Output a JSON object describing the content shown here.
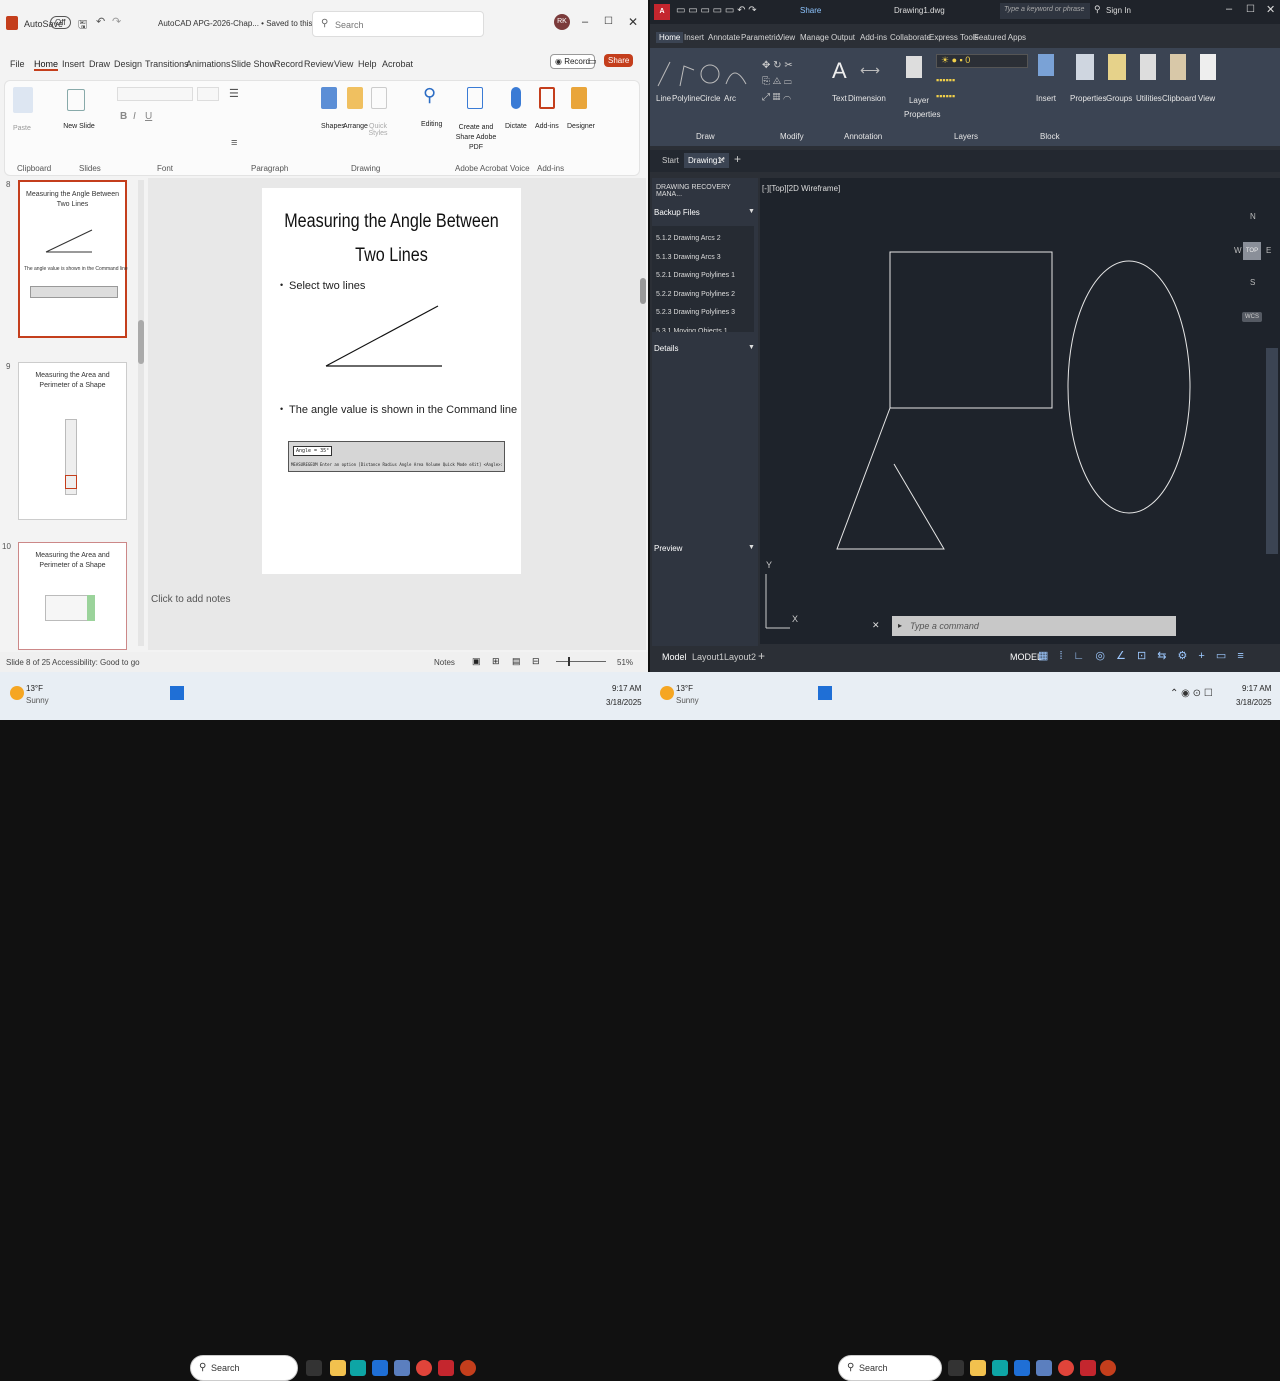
{
  "ppt": {
    "autosave": "AutoSave",
    "autosave_state": "Off",
    "title": "AutoCAD APG-2026-Chap... • Saved to this PC",
    "search_placeholder": "Search",
    "avatar": "RK",
    "record": "Record",
    "share": "Share",
    "tabs": [
      "File",
      "Home",
      "Insert",
      "Draw",
      "Design",
      "Transitions",
      "Animations",
      "Slide Show",
      "Record",
      "Review",
      "View",
      "Help",
      "Acrobat"
    ],
    "ribbon_buttons": {
      "paste": "Paste",
      "new_slide": "New Slide",
      "shapes": "Shapes",
      "arrange": "Arrange",
      "quick_styles": "Quick Styles",
      "editing": "Editing",
      "create_pdf": "Create and Share Adobe PDF",
      "dictate": "Dictate",
      "addins": "Add-ins",
      "designer": "Designer"
    },
    "groups": [
      "Clipboard",
      "Slides",
      "Font",
      "Paragraph",
      "Drawing",
      "Adobe Acrobat",
      "Voice",
      "Add-ins"
    ],
    "thumbnails": [
      {
        "num": "8",
        "title": "Measuring the Angle Between Two Lines",
        "caption": "The angle value is shown in the Command line"
      },
      {
        "num": "9",
        "title": "Measuring the Area and Perimeter of a Shape",
        "caption": ""
      },
      {
        "num": "10",
        "title": "Measuring the Area and Perimeter of a Shape",
        "caption": ""
      }
    ],
    "slide": {
      "title": "Measuring the Angle Between Two Lines",
      "bullet1": "Select two lines",
      "bullet2": "The angle value is shown in the Command line",
      "cmd_line1": "Angle = 35°",
      "cmd_line2": "MEASUREGEOM Enter an option [Distance Radius Angle Area Volume Quick Mode eXit] <Angle>:"
    },
    "notes": "Click to add notes",
    "status": {
      "slide": "Slide 8 of 25",
      "accessibility": "Accessibility: Good to go",
      "notes": "Notes",
      "zoom": "51%"
    }
  },
  "acad": {
    "title": "Drawing1.dwg",
    "share": "Share",
    "search_placeholder": "Type a keyword or phrase",
    "signin": "Sign In",
    "tabs": [
      "Home",
      "Insert",
      "Annotate",
      "Parametric",
      "View",
      "Manage",
      "Output",
      "Add-ins",
      "Collaborate",
      "Express Tools",
      "Featured Apps"
    ],
    "draw_tools": [
      "Line",
      "Polyline",
      "Circle",
      "Arc"
    ],
    "tools2": [
      "Text",
      "Dimension",
      "Layer Properties",
      "Insert",
      "Properties",
      "Groups",
      "Utilities",
      "Clipboard",
      "View"
    ],
    "panels": [
      "Draw",
      "Modify",
      "Annotation",
      "Layers",
      "Block"
    ],
    "file_tabs": [
      "Start",
      "Drawing1*"
    ],
    "recovery": {
      "title": "DRAWING RECOVERY MANA...",
      "backup": "Backup Files",
      "files": [
        "5.1.2 Drawing Arcs 2",
        "5.1.3 Drawing Arcs 3",
        "5.2.1 Drawing Polylines 1",
        "5.2.2 Drawing Polylines 2",
        "5.2.3 Drawing Polylines 3",
        "5.3.1 Moving Objects 1"
      ],
      "details": "Details",
      "preview": "Preview"
    },
    "viewport_label": "[-][Top][2D Wireframe]",
    "compass": {
      "n": "N",
      "s": "S",
      "e": "E",
      "w": "W",
      "top": "TOP",
      "wcs": "WCS"
    },
    "cmd_placeholder": "Type a command",
    "layouts": [
      "Model",
      "Layout1",
      "Layout2"
    ],
    "status_model": "MODEL"
  },
  "taskbar_left": {
    "temp": "13°F",
    "cond": "Sunny",
    "search": "Search",
    "time": "9:17 AM",
    "date": "3/18/2025"
  },
  "taskbar_right": {
    "temp": "13°F",
    "cond": "Sunny",
    "search": "Search",
    "time": "9:17 AM",
    "date": "3/18/2025"
  }
}
